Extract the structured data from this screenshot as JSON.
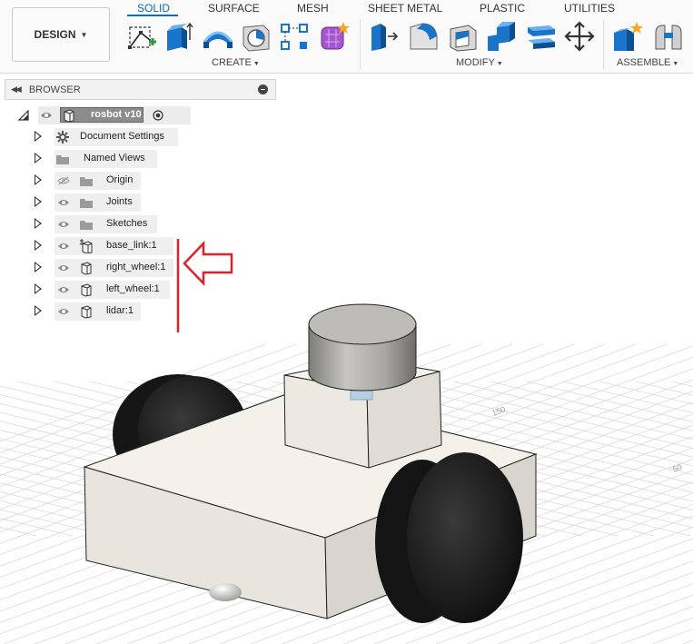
{
  "workspace": {
    "label": "DESIGN"
  },
  "tabs": [
    "SOLID",
    "SURFACE",
    "MESH",
    "SHEET METAL",
    "PLASTIC",
    "UTILITIES"
  ],
  "groups": {
    "create": "CREATE",
    "modify": "MODIFY",
    "assemble": "ASSEMBLE"
  },
  "browser": {
    "title": "BROWSER",
    "root": "rosbot v10",
    "items": [
      {
        "label": "Document Settings",
        "icon": "gear-icon"
      },
      {
        "label": "Named Views",
        "icon": "folder-icon"
      },
      {
        "label": "Origin",
        "icon": "folder-icon",
        "hidden": true
      },
      {
        "label": "Joints",
        "icon": "folder-icon"
      },
      {
        "label": "Sketches",
        "icon": "folder-icon"
      },
      {
        "label": "base_link:1",
        "icon": "grounded-component-icon"
      },
      {
        "label": "right_wheel:1",
        "icon": "component-icon"
      },
      {
        "label": "left_wheel:1",
        "icon": "component-icon"
      },
      {
        "label": "lidar:1",
        "icon": "component-icon"
      }
    ]
  },
  "viewport": {
    "grid_labels": [
      "150",
      "50"
    ]
  },
  "colors": {
    "accent": "#0a6bc2",
    "annotation": "#e0202a",
    "body": "#efece6",
    "wheel": "#111111"
  }
}
